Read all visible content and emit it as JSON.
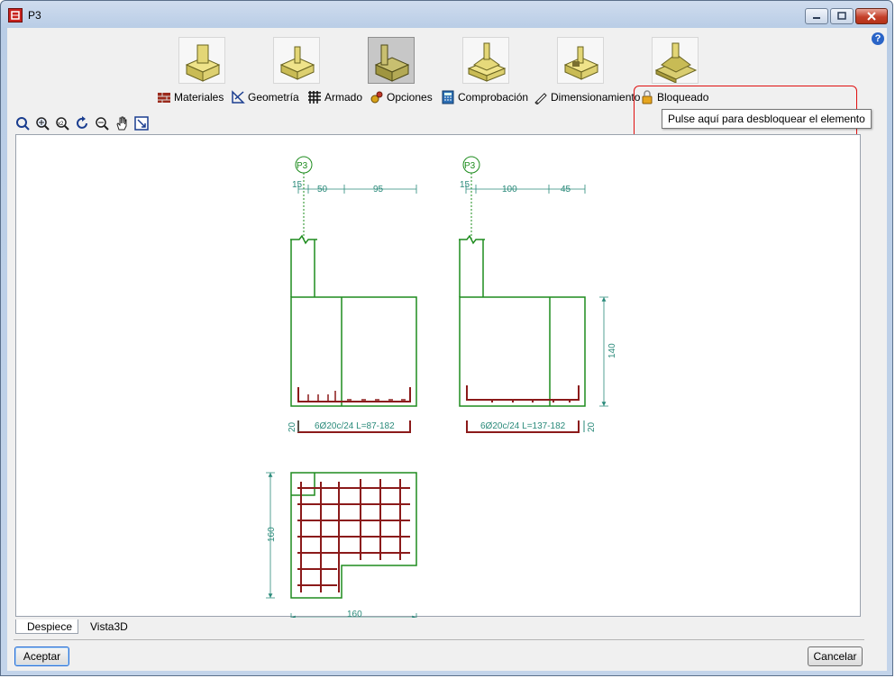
{
  "window": {
    "title": "P3"
  },
  "toolbar": {
    "menu": [
      {
        "label": "Materiales",
        "icon": "bricks-icon"
      },
      {
        "label": "Geometría",
        "icon": "set-square-icon"
      },
      {
        "label": "Armado",
        "icon": "rebar-grid-icon"
      },
      {
        "label": "Opciones",
        "icon": "gears-icon"
      },
      {
        "label": "Comprobación",
        "icon": "calculator-icon"
      },
      {
        "label": "Dimensionamiento",
        "icon": "pen-icon"
      },
      {
        "label": "Bloqueado",
        "icon": "padlock-icon"
      }
    ],
    "tooltip": "Pulse aquí para desbloquear el elemento"
  },
  "drawing": {
    "column_label": "P3",
    "left_elevation": {
      "dims_top": [
        "15",
        "50",
        "95"
      ],
      "side_dim": "20",
      "bar_label": "6Ø20c/24 L=87-182"
    },
    "right_elevation": {
      "dims_top": [
        "15",
        "100",
        "45"
      ],
      "height_dim": "140",
      "side_dim": "20",
      "bar_label": "6Ø20c/24 L=137-182"
    },
    "plan": {
      "height_dim": "160",
      "width_dim": "160"
    }
  },
  "tabs": [
    {
      "label": "Despiece",
      "active": true
    },
    {
      "label": "Vista3D",
      "active": false
    }
  ],
  "buttons": {
    "accept": "Aceptar",
    "cancel": "Cancelar"
  },
  "colors": {
    "outline": "#1e8c1e",
    "rebar": "#8b1a1a",
    "dims": "#2a8a7a"
  }
}
